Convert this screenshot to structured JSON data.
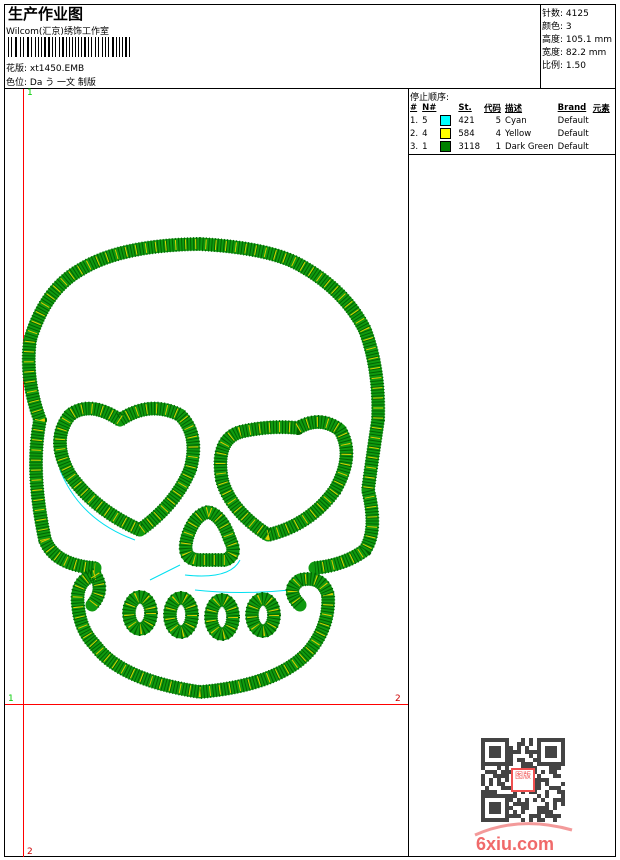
{
  "header": {
    "title": "生产作业图",
    "studio": "Wilcom(汇京)绣饰工作室",
    "design_label": "花版: xt1450.EMB",
    "colorway_label": "色位: Da う 一文 制版"
  },
  "info": {
    "stitches": "针数: 4125",
    "colors": "颜色: 3",
    "height": "高度: 105.1 mm",
    "width": "宽度: 82.2 mm",
    "scale": "比例: 1.50"
  },
  "stop_sequence": {
    "title": "停止顺序:",
    "columns": [
      "#",
      "N#",
      "",
      "St.",
      "代码",
      "描述",
      "Brand",
      "元素"
    ],
    "rows": [
      {
        "idx": "1.",
        "n": "5",
        "color": "#00ffff",
        "st": "421",
        "code": "5",
        "desc": "Cyan",
        "brand": "Default"
      },
      {
        "idx": "2.",
        "n": "4",
        "color": "#ffff00",
        "st": "584",
        "code": "4",
        "desc": "Yellow",
        "brand": "Default"
      },
      {
        "idx": "3.",
        "n": "1",
        "color": "#008000",
        "st": "3118",
        "code": "1",
        "desc": "Dark Green",
        "brand": "Default"
      }
    ]
  },
  "markers": {
    "v_top": "1",
    "v_bottom": "2",
    "h_left": "1",
    "h_right": "2"
  },
  "watermark": "6xiu.com",
  "stamp": "以图版"
}
